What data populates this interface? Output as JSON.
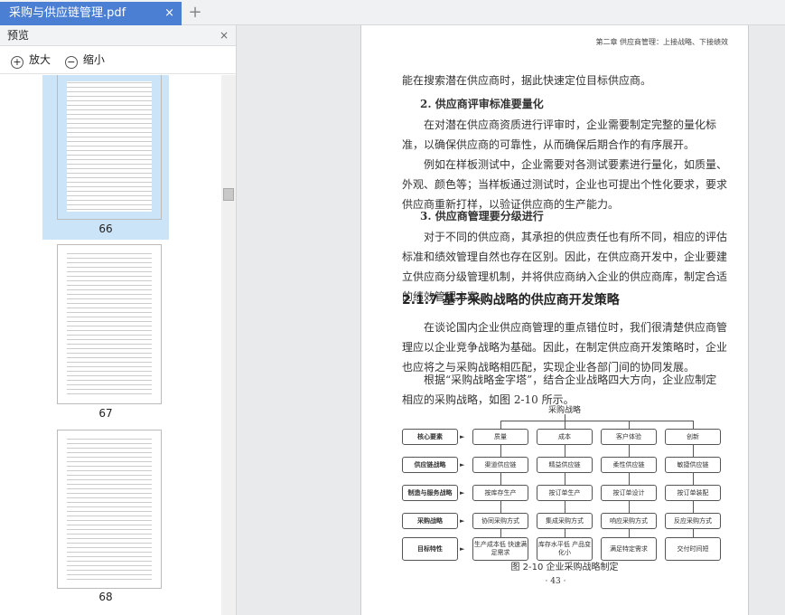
{
  "tab": {
    "title": "采购与供应链管理.pdf",
    "close": "×",
    "new": "+"
  },
  "panel": {
    "title": "预览",
    "close": "×",
    "zoom_in": "放大",
    "zoom_out": "缩小"
  },
  "thumbnails": [
    {
      "page": "66",
      "selected": true
    },
    {
      "page": "67",
      "selected": false
    },
    {
      "page": "68",
      "selected": false
    }
  ],
  "page": {
    "header": "第二章 供应商管理：上接战略、下接绩效",
    "paras": [
      "能在搜索潜在供应商时，据此快速定位目标供应商。",
      "2. 供应商评审标准要量化",
      "在对潜在供应商资质进行评审时，企业需要制定完整的量化标准，以确保供应商的可靠性，从而确保后期合作的有序展开。",
      "例如在样板测试中，企业需要对各测试要素进行量化，如质量、外观、颜色等；当样板通过测试时，企业也可提出个性化要求，要求供应商重新打样，以验证供应商的生产能力。",
      "3. 供应商管理要分级进行",
      "对于不同的供应商，其承担的供应责任也有所不同，相应的评估标准和绩效管理自然也存在区别。因此，在供应商开发中，企业要建立供应商分级管理机制，并将供应商纳入企业的供应商库，制定合适的绩效管理方案。",
      "2.1.7  基于采购战略的供应商开发策略",
      "在谈论国内企业供应商管理的重点错位时，我们很清楚供应商管理应以企业竞争战略为基础。因此，在制定供应商开发策略时，企业也应将之与采购战略相匹配，实现企业各部门间的协同发展。",
      "根据“采购战略金字塔”，结合企业战略四大方向，企业应制定相应的采购战略，如图 2-10 所示。"
    ],
    "diagram": {
      "title": "采购战略",
      "rows": [
        {
          "label": "核心要素",
          "cells": [
            "质量",
            "成本",
            "客户体验",
            "创新"
          ]
        },
        {
          "label": "供应链战略",
          "cells": [
            "渠道供应链",
            "精益供应链",
            "柔性供应链",
            "敏捷供应链"
          ]
        },
        {
          "label": "制造与服务战略",
          "cells": [
            "按库存生产",
            "按订单生产",
            "按订单设计",
            "按订单装配"
          ]
        },
        {
          "label": "采购战略",
          "cells": [
            "协同采购方式",
            "集成采购方式",
            "响应采购方式",
            "反应采购方式"
          ]
        },
        {
          "label": "目标特性",
          "cells": [
            "生产成本低 快速满足需求",
            "库存水平低 产品变化小",
            "满足特定需求",
            "交付时间短"
          ]
        }
      ]
    },
    "caption": "图 2-10  企业采购战略制定",
    "page_number": "· 43 ·"
  }
}
